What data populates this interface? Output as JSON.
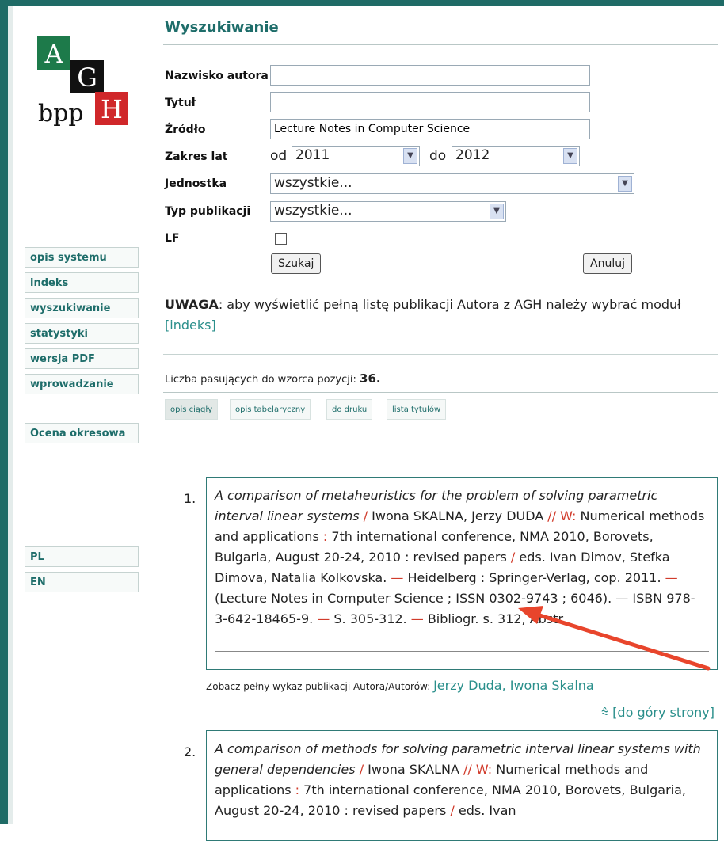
{
  "logo": {
    "a": "A",
    "g": "G",
    "h": "H",
    "bpp": "bpp"
  },
  "nav": {
    "items": [
      "opis systemu",
      "indeks",
      "wyszukiwanie",
      "statystyki",
      "wersja PDF",
      "wprowadzanie"
    ],
    "extra": "Ocena okresowa",
    "lang": [
      "PL",
      "EN"
    ]
  },
  "page_title": "Wyszukiwanie",
  "form": {
    "author_label": "Nazwisko autora",
    "author_value": "",
    "title_label": "Tytuł",
    "title_value": "",
    "source_label": "Źródło",
    "source_value": "Lecture Notes in Computer Science",
    "years_label": "Zakres lat",
    "from_label": "od",
    "from_value": "2011",
    "to_label": "do",
    "to_value": "2012",
    "unit_label": "Jednostka",
    "unit_value": "wszystkie...",
    "type_label": "Typ publikacji",
    "type_value": "wszystkie...",
    "lf_label": "LF",
    "search_button": "Szukaj",
    "cancel_button": "Anuluj"
  },
  "notice": {
    "bold": "UWAGA",
    "text": ": aby wyświetlić pełną listę publikacji Autora z AGH należy wybrać moduł ",
    "link": "indeks",
    "open_bracket": "[",
    "close_bracket": "]"
  },
  "results": {
    "count_label": "Liczba pasujących do wzorca pozycji: ",
    "count_value": "36.",
    "tabs": [
      "opis ciągły",
      "opis tabelaryczny",
      "do druku",
      "lista tytułów"
    ],
    "records": [
      {
        "num": "1.",
        "title": "A comparison of metaheuristics for the problem of solving parametric interval linear systems",
        "sep1": " / ",
        "authors": "Iwona SKALNA, Jerzy DUDA",
        "sep2": " // W: ",
        "in": "Numerical methods and applications",
        "sep3": " : ",
        "conf": "7th international conference, NMA 2010, Borovets, Bulgaria, August 20-24, 2010 : revised papers",
        "sep4": " / ",
        "eds": "eds. Ivan Dimov, Stefka Dimova, Natalia Kolkovska.",
        "sep5": " — ",
        "pub": "Heidelberg : Springer-Verlag, cop. 2011.",
        "sep6": " — ",
        "series": "(Lecture Notes in Computer Science ; ISSN 0302-9743 ; 6046). — ISBN 978-3-642-18465-9.",
        "sep7": " — ",
        "pages": "S. 305-312.",
        "sep8": " — ",
        "notes": "Bibliogr. s. 312, Abstr."
      },
      {
        "num": "2.",
        "title": "A comparison of methods for solving parametric interval linear systems with general dependencies",
        "sep1": " / ",
        "authors": "Iwona SKALNA",
        "sep2": " // W: ",
        "in": "Numerical methods and applications",
        "sep3": " : ",
        "conf": "7th international conference, NMA 2010, Borovets, Bulgaria, August 20-24, 2010 : revised papers",
        "sep4": " / ",
        "eds": "eds. Ivan"
      }
    ],
    "see_all_label": "Zobacz pełny wykaz publikacji Autora/Autorów: ",
    "see_all_link": "Jerzy Duda, Iwona Skalna",
    "top_link": "⩯ [do góry strony]"
  },
  "colors": {
    "accent": "#1e6d6a",
    "frame": "#1f6b66",
    "annotation_arrow": "#e8452c",
    "red_sep": "#d13b2b"
  }
}
